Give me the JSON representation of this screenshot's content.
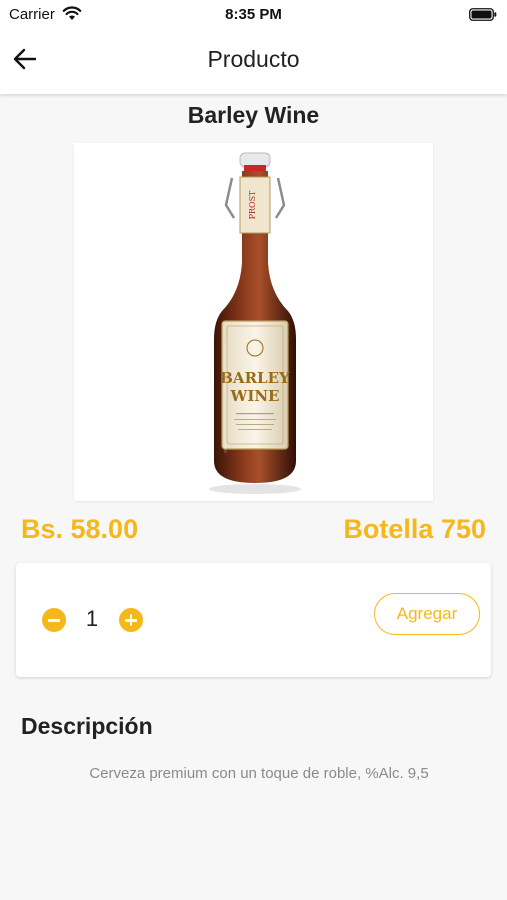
{
  "status_bar": {
    "carrier": "Carrier",
    "time": "8:35 PM"
  },
  "app_bar": {
    "title": "Producto",
    "back_icon": "arrow-left-icon"
  },
  "product": {
    "name": "Barley Wine",
    "price": "Bs. 58.00",
    "presentation": "Botella 750",
    "image_label_line1": "BARLEY",
    "image_label_line2": "WINE",
    "image_neck_label": "PROST"
  },
  "quantity": {
    "value": "1",
    "minus_icon": "minus-circle-icon",
    "plus_icon": "plus-circle-icon",
    "add_label": "Agregar"
  },
  "description": {
    "title": "Descripción",
    "text": "Cerveza premium con un toque de roble, %Alc. 9,5"
  },
  "colors": {
    "accent": "#f5b81b",
    "background": "#f7f7f7",
    "text": "#222222",
    "muted": "#8a8a8a"
  }
}
